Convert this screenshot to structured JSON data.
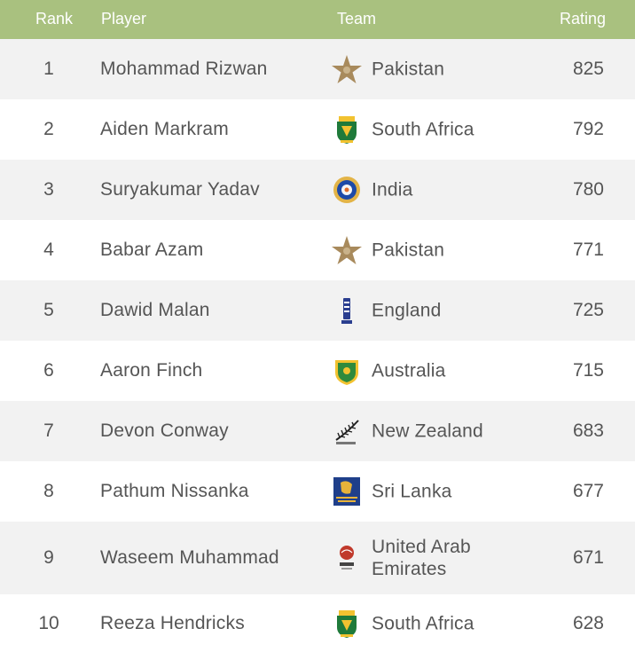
{
  "header": {
    "rank": "Rank",
    "player": "Player",
    "team": "Team",
    "rating": "Rating"
  },
  "rows": [
    {
      "rank": "1",
      "player": "Mohammad Rizwan",
      "team": "Pakistan",
      "rating": "825",
      "logo": "pakistan-star-icon"
    },
    {
      "rank": "2",
      "player": "Aiden Markram",
      "team": "South Africa",
      "rating": "792",
      "logo": "south-africa-crest-icon"
    },
    {
      "rank": "3",
      "player": "Suryakumar Yadav",
      "team": "India",
      "rating": "780",
      "logo": "india-bcci-icon"
    },
    {
      "rank": "4",
      "player": "Babar Azam",
      "team": "Pakistan",
      "rating": "771",
      "logo": "pakistan-star-icon"
    },
    {
      "rank": "5",
      "player": "Dawid Malan",
      "team": "England",
      "rating": "725",
      "logo": "england-ecb-icon"
    },
    {
      "rank": "6",
      "player": "Aaron Finch",
      "team": "Australia",
      "rating": "715",
      "logo": "australia-crest-icon"
    },
    {
      "rank": "7",
      "player": "Devon Conway",
      "team": "New Zealand",
      "rating": "683",
      "logo": "new-zealand-fern-icon"
    },
    {
      "rank": "8",
      "player": "Pathum Nissanka",
      "team": "Sri Lanka",
      "rating": "677",
      "logo": "sri-lanka-lion-icon"
    },
    {
      "rank": "9",
      "player": "Waseem Muhammad",
      "team": "United Arab Emirates",
      "rating": "671",
      "logo": "uae-cricket-icon"
    },
    {
      "rank": "10",
      "player": "Reeza Hendricks",
      "team": "South Africa",
      "rating": "628",
      "logo": "south-africa-crest-icon"
    }
  ],
  "colors": {
    "header_bg": "#a9c17f",
    "row_alt": "#f2f2f2",
    "text": "#555555"
  }
}
